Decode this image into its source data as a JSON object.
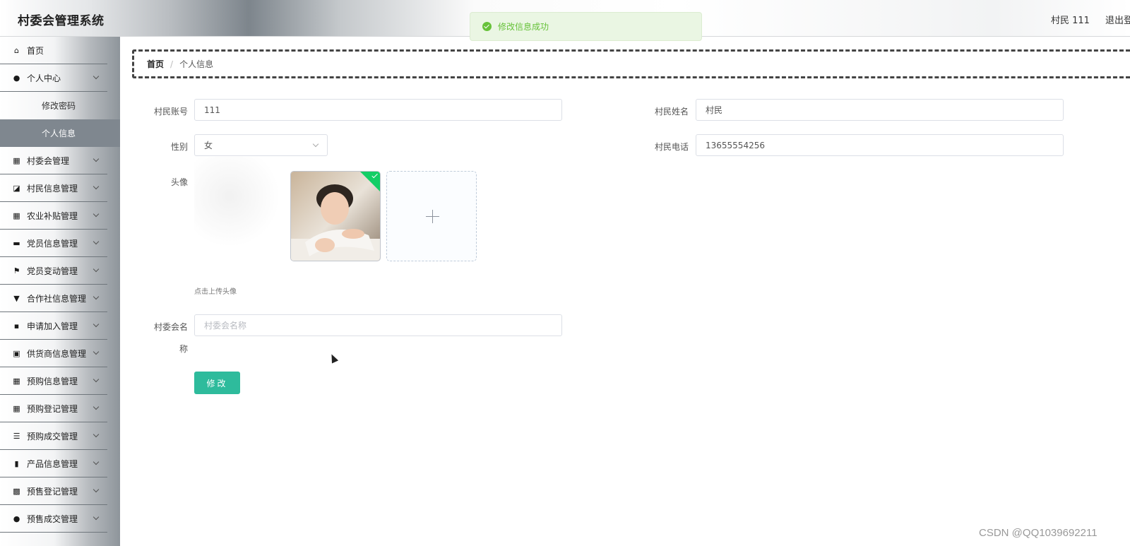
{
  "header": {
    "title": "村委会管理系统",
    "user": "村民 111",
    "logout": "退出登录"
  },
  "toast": {
    "message": "修改信息成功"
  },
  "sidebar": {
    "items": [
      {
        "label": "首页",
        "icon": "home-icon"
      },
      {
        "label": "个人中心",
        "icon": "user-icon"
      },
      {
        "label": "村委会管理",
        "icon": "grid-icon"
      },
      {
        "label": "村民信息管理",
        "icon": "chart-icon"
      },
      {
        "label": "农业补贴管理",
        "icon": "grid-icon"
      },
      {
        "label": "党员信息管理",
        "icon": "monitor-icon"
      },
      {
        "label": "党员变动管理",
        "icon": "flag-icon"
      },
      {
        "label": "合作社信息管理",
        "icon": "pin-icon"
      },
      {
        "label": "申请加入管理",
        "icon": "message-icon"
      },
      {
        "label": "供货商信息管理",
        "icon": "clipboard-icon"
      },
      {
        "label": "预购信息管理",
        "icon": "grid-icon"
      },
      {
        "label": "预购登记管理",
        "icon": "grid-icon"
      },
      {
        "label": "预购成交管理",
        "icon": "list-icon"
      },
      {
        "label": "产品信息管理",
        "icon": "bar-chart-icon"
      },
      {
        "label": "预售登记管理",
        "icon": "grid9-icon"
      },
      {
        "label": "预售成交管理",
        "icon": "user-icon"
      }
    ],
    "sub_items": [
      {
        "label": "修改密码"
      },
      {
        "label": "个人信息"
      }
    ]
  },
  "breadcrumb": {
    "home": "首页",
    "separator": "/",
    "current": "个人信息"
  },
  "form": {
    "account_label": "村民账号",
    "account_value": "111",
    "name_label": "村民姓名",
    "name_value": "村民",
    "gender_label": "性别",
    "gender_value": "女",
    "phone_label": "村民电话",
    "phone_value": "13655554256",
    "avatar_label": "头像",
    "avatar_tip": "点击上传头像",
    "committee_label_1": "村委会名",
    "committee_label_2": "称",
    "committee_placeholder": "村委会名称",
    "submit": "修改"
  },
  "watermark": "CSDN @QQ1039692211",
  "colors": {
    "primary_button": "#2ebb9c",
    "toast_success": "#67c23a",
    "active_menu": "#7f878f"
  }
}
